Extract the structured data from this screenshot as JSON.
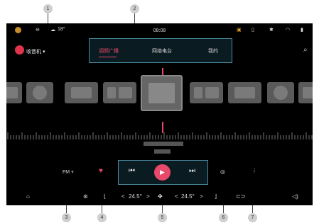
{
  "callouts": [
    "1",
    "2",
    "3",
    "4",
    "5",
    "6",
    "7"
  ],
  "status": {
    "time": "08:08",
    "temperature": "18°",
    "icons": [
      "avatar-icon",
      "minus-circle-icon",
      "cloud-icon",
      "camera-icon",
      "vibrate-icon",
      "bluetooth-icon",
      "wifi-icon",
      "signal-icon"
    ]
  },
  "app": {
    "title": "收音机",
    "tabs": [
      "调频广播",
      "网络电台",
      "我的"
    ],
    "active_tab": 0
  },
  "player": {
    "band": "FM",
    "favorite": true,
    "prev_icon": "previous-icon",
    "play_icon": "play-icon",
    "next_icon": "next-icon"
  },
  "climate": {
    "left_temp": "24.5°",
    "right_temp": "24.5°",
    "left_decrease": "<",
    "left_increase": ">",
    "right_decrease": "<",
    "right_increase": ">"
  },
  "dock": {
    "icons": [
      "home-icon",
      "defrost-icon",
      "seat-icon",
      "fan-icon",
      "seat-heat-icon",
      "car-icon",
      "volume-icon"
    ]
  }
}
